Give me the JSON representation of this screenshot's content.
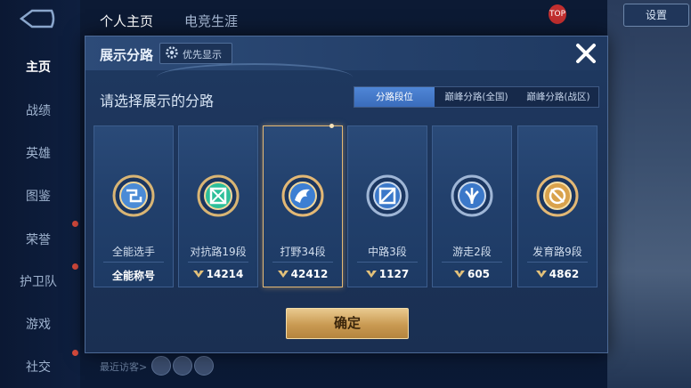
{
  "sidebar": {
    "items": [
      {
        "label": "主页",
        "active": true
      },
      {
        "label": "战绩"
      },
      {
        "label": "英雄"
      },
      {
        "label": "图鉴"
      },
      {
        "label": "荣誉"
      },
      {
        "label": "护卫队"
      },
      {
        "label": "游戏"
      },
      {
        "label": "社交"
      }
    ]
  },
  "top_tabs": [
    "个人主页",
    "电竞生涯"
  ],
  "top_right": {
    "badge": "TOP",
    "button_label": "设置"
  },
  "visitors_label": "最近访客>",
  "modal": {
    "title": "展示分路",
    "priority_label": "优先显示",
    "subtitle": "请选择展示的分路",
    "tabs": [
      {
        "label": "分路段位",
        "active": true
      },
      {
        "label": "巅峰分路(全国)"
      },
      {
        "label": "巅峰分路(战区)"
      }
    ],
    "cards": [
      {
        "name": "全能选手",
        "stat": "全能称号",
        "has_icon": false,
        "emblem": "all-role-emblem"
      },
      {
        "name": "对抗路19段",
        "stat": "14214",
        "has_icon": true,
        "emblem": "clash-lane-emblem"
      },
      {
        "name": "打野34段",
        "stat": "42412",
        "has_icon": true,
        "emblem": "jungle-emblem",
        "selected": true
      },
      {
        "name": "中路3段",
        "stat": "1127",
        "has_icon": true,
        "emblem": "mid-lane-emblem"
      },
      {
        "name": "游走2段",
        "stat": "605",
        "has_icon": true,
        "emblem": "roam-emblem"
      },
      {
        "name": "发育路9段",
        "stat": "4862",
        "has_icon": true,
        "emblem": "farm-lane-emblem"
      }
    ],
    "confirm_label": "确定"
  },
  "colors": {
    "accent_gold": "#e3b875",
    "tab_active": "#4f86d6",
    "modal_bg": "#1f3961"
  }
}
